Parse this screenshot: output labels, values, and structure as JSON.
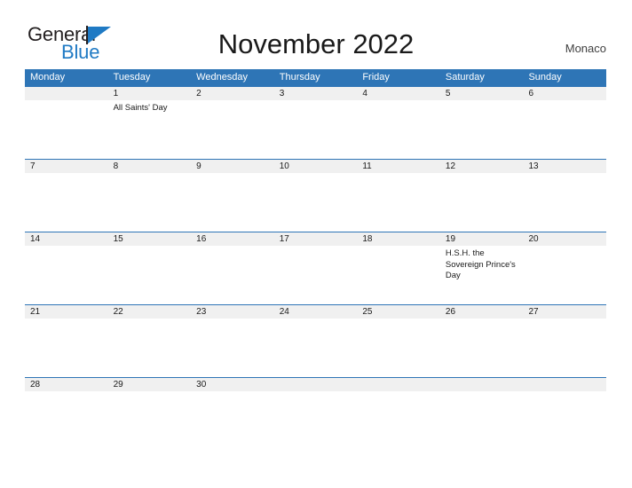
{
  "brand": {
    "name_part1": "General",
    "name_part2": "Blue",
    "color_primary": "#1f7ac4",
    "color_text": "#231f20"
  },
  "header": {
    "title": "November 2022",
    "location": "Monaco",
    "header_bg_color": "#2e75b6",
    "date_band_color": "#f0f0f0"
  },
  "calendar": {
    "weekdays": [
      "Monday",
      "Tuesday",
      "Wednesday",
      "Thursday",
      "Friday",
      "Saturday",
      "Sunday"
    ],
    "weeks": [
      {
        "dates": [
          "",
          "1",
          "2",
          "3",
          "4",
          "5",
          "6"
        ],
        "events": [
          "",
          "All Saints' Day",
          "",
          "",
          "",
          "",
          ""
        ]
      },
      {
        "dates": [
          "7",
          "8",
          "9",
          "10",
          "11",
          "12",
          "13"
        ],
        "events": [
          "",
          "",
          "",
          "",
          "",
          "",
          ""
        ]
      },
      {
        "dates": [
          "14",
          "15",
          "16",
          "17",
          "18",
          "19",
          "20"
        ],
        "events": [
          "",
          "",
          "",
          "",
          "",
          "H.S.H. the Sovereign Prince's Day",
          ""
        ]
      },
      {
        "dates": [
          "21",
          "22",
          "23",
          "24",
          "25",
          "26",
          "27"
        ],
        "events": [
          "",
          "",
          "",
          "",
          "",
          "",
          ""
        ]
      },
      {
        "dates": [
          "28",
          "29",
          "30",
          "",
          "",
          "",
          ""
        ],
        "events": [
          "",
          "",
          "",
          "",
          "",
          "",
          ""
        ]
      }
    ]
  }
}
